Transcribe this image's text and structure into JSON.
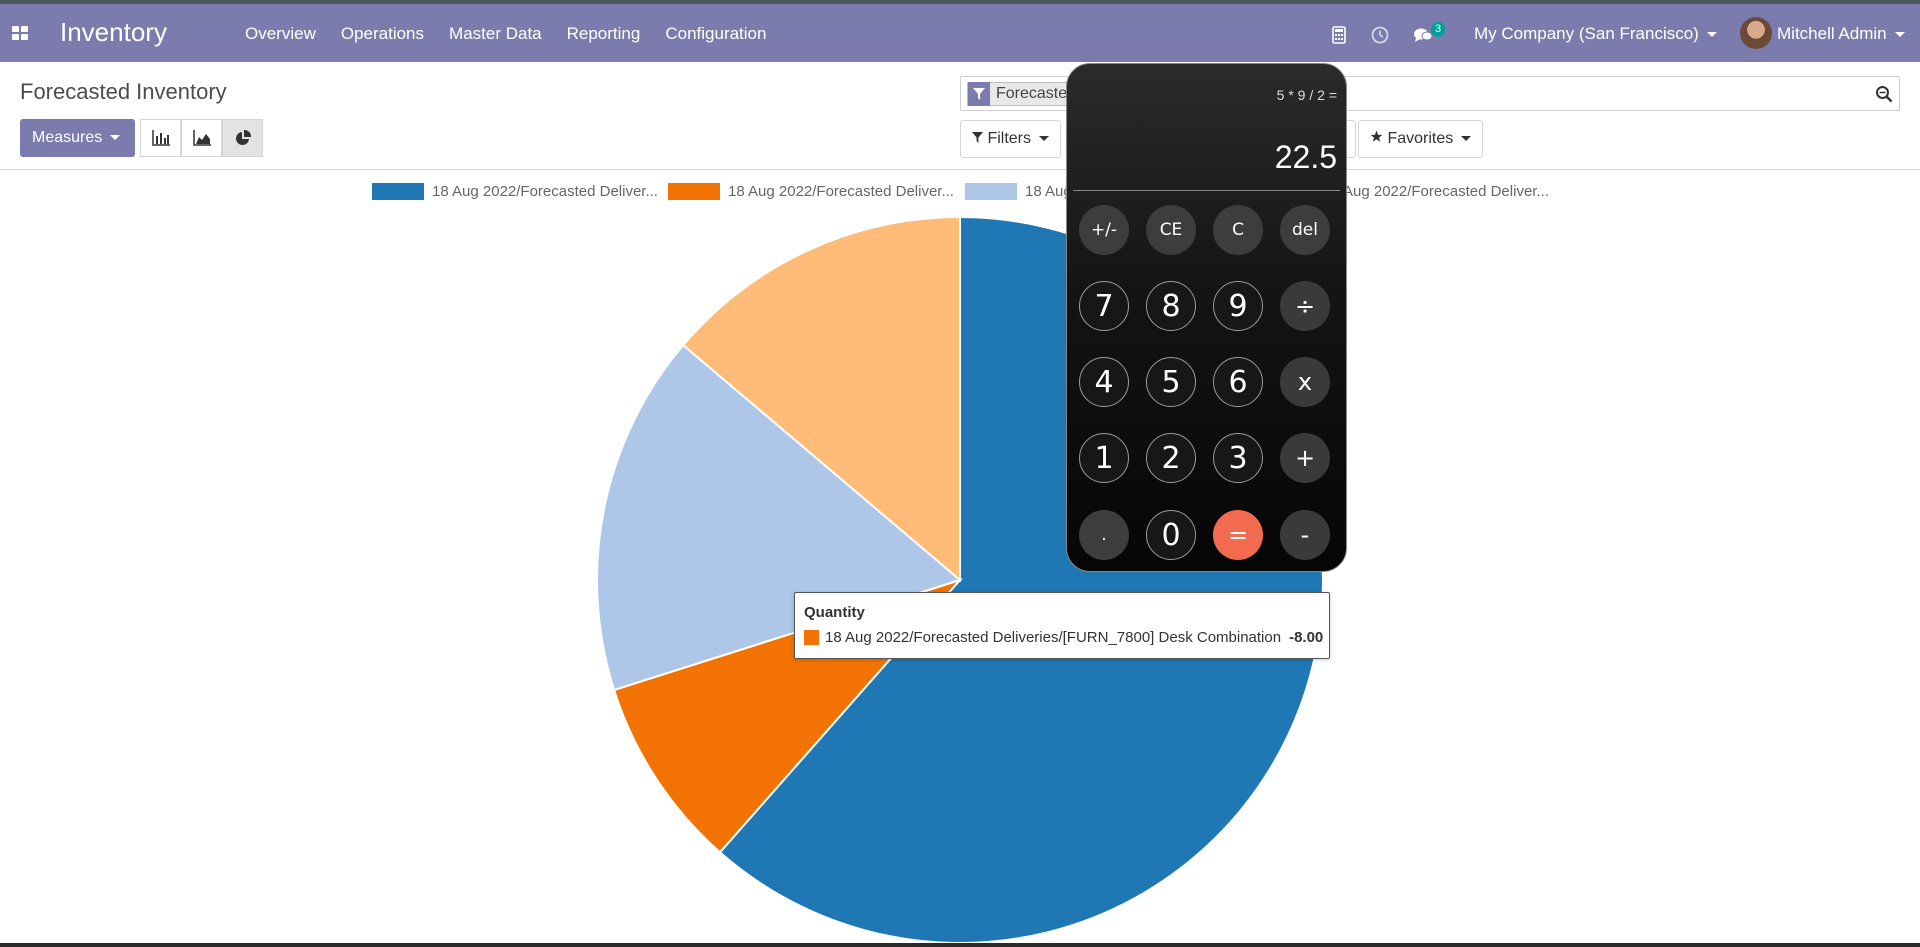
{
  "navbar": {
    "app_name": "Inventory",
    "menu": [
      "Overview",
      "Operations",
      "Master Data",
      "Reporting",
      "Configuration"
    ],
    "message_count": "3",
    "company": "My Company (San Francisco)",
    "user": "Mitchell Admin",
    "color": "#7c7bad"
  },
  "control_panel": {
    "title": "Forecasted Inventory",
    "measures_label": "Measures",
    "facet_label": "Forecaste",
    "filters_label": "Filters",
    "favorites_label": "Favorites"
  },
  "legend": [
    {
      "label": "18 Aug 2022/Forecasted Deliver...",
      "color": "#1f77b4"
    },
    {
      "label": "18 Aug 2022/Forecasted Deliver...",
      "color": "#ff7f0e"
    },
    {
      "label": "18 Aug",
      "color": "#aec7e8"
    },
    {
      "label": "Aug 2022/Forecasted Deliver...",
      "color": "#ffbb78"
    }
  ],
  "chart_data": {
    "type": "pie",
    "values": [
      61.5,
      8.6,
      16.1,
      13.8
    ],
    "colors": [
      "#1f77b4",
      "#f27303",
      "#aec7e8",
      "#ffbb78"
    ]
  },
  "tooltip": {
    "title": "Quantity",
    "label": "18 Aug 2022/Forecasted Deliveries/[FURN_7800] Desk Combination",
    "value": "-8.00"
  },
  "calculator": {
    "expression": "5 * 9 / 2 =",
    "result": "22.5",
    "keys": [
      {
        "label": "+/-",
        "kind": "fn",
        "name": "negate-key"
      },
      {
        "label": "CE",
        "kind": "fn",
        "name": "clear-entry-key"
      },
      {
        "label": "C",
        "kind": "fn",
        "name": "clear-key"
      },
      {
        "label": "del",
        "kind": "fn",
        "name": "delete-key"
      },
      {
        "label": "7",
        "kind": "num",
        "name": "digit-7-key"
      },
      {
        "label": "8",
        "kind": "num",
        "name": "digit-8-key"
      },
      {
        "label": "9",
        "kind": "num",
        "name": "digit-9-key"
      },
      {
        "label": "÷",
        "kind": "op",
        "name": "divide-key"
      },
      {
        "label": "4",
        "kind": "num",
        "name": "digit-4-key"
      },
      {
        "label": "5",
        "kind": "num",
        "name": "digit-5-key"
      },
      {
        "label": "6",
        "kind": "num",
        "name": "digit-6-key"
      },
      {
        "label": "x",
        "kind": "op",
        "name": "multiply-key"
      },
      {
        "label": "1",
        "kind": "num",
        "name": "digit-1-key"
      },
      {
        "label": "2",
        "kind": "num",
        "name": "digit-2-key"
      },
      {
        "label": "3",
        "kind": "num",
        "name": "digit-3-key"
      },
      {
        "label": "+",
        "kind": "op",
        "name": "add-key"
      },
      {
        "label": ".",
        "kind": "fn",
        "name": "decimal-key"
      },
      {
        "label": "0",
        "kind": "num",
        "name": "digit-0-key"
      },
      {
        "label": "=",
        "kind": "eq",
        "name": "equals-key"
      },
      {
        "label": "-",
        "kind": "op",
        "name": "subtract-key"
      }
    ]
  }
}
